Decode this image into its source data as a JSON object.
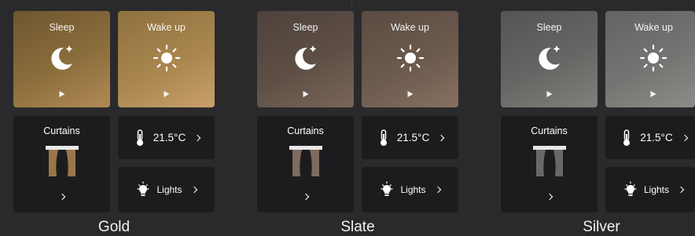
{
  "themes": [
    {
      "name": "Gold",
      "accent": "#b08a55",
      "curtain_color": "#9a7748",
      "scenes": [
        {
          "label": "Sleep",
          "icon": "moon-icon",
          "action": "play-icon"
        },
        {
          "label": "Wake up",
          "icon": "sun-icon",
          "action": "play-icon"
        }
      ],
      "curtains": {
        "label": "Curtains",
        "icon": "curtains-icon"
      },
      "temperature": {
        "value": "21.5°C",
        "icon": "thermometer-icon"
      },
      "lights": {
        "label": "Lights",
        "icon": "lightbulb-icon"
      }
    },
    {
      "name": "Slate",
      "accent": "#7a6658",
      "curtain_color": "#7e6a5e",
      "scenes": [
        {
          "label": "Sleep",
          "icon": "moon-icon",
          "action": "play-icon"
        },
        {
          "label": "Wake up",
          "icon": "sun-icon",
          "action": "play-icon"
        }
      ],
      "curtains": {
        "label": "Curtains",
        "icon": "curtains-icon"
      },
      "temperature": {
        "value": "21.5°C",
        "icon": "thermometer-icon"
      },
      "lights": {
        "label": "Lights",
        "icon": "lightbulb-icon"
      }
    },
    {
      "name": "Silver",
      "accent": "#82807c",
      "curtain_color": "#6a6866",
      "scenes": [
        {
          "label": "Sleep",
          "icon": "moon-icon",
          "action": "play-icon"
        },
        {
          "label": "Wake up",
          "icon": "sun-icon",
          "action": "play-icon"
        }
      ],
      "curtains": {
        "label": "Curtains",
        "icon": "curtains-icon"
      },
      "temperature": {
        "value": "21.5°C",
        "icon": "thermometer-icon"
      },
      "lights": {
        "label": "Lights",
        "icon": "lightbulb-icon"
      }
    }
  ]
}
